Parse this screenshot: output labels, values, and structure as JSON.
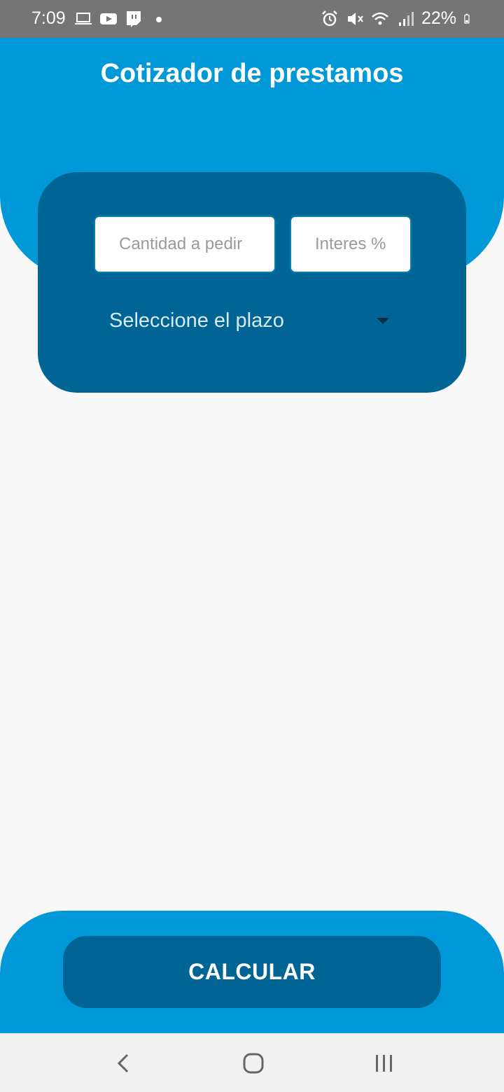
{
  "status_bar": {
    "time": "7:09",
    "battery": "22%",
    "left_icons": [
      "laptop-icon",
      "youtube-icon",
      "twitch-icon",
      "dot-icon"
    ],
    "right_icons": [
      "alarm-icon",
      "mute-icon",
      "wifi-icon",
      "signal-icon",
      "battery-icon"
    ]
  },
  "header": {
    "title": "Cotizador de prestamos",
    "color": "#0098d6"
  },
  "form": {
    "amount_placeholder": "Cantidad a pedir",
    "rate_placeholder": "Interes %",
    "term_select_label": "Seleccione el plazo",
    "card_color": "#006594"
  },
  "actions": {
    "calculate_label": "CALCULAR"
  },
  "nav_bar": {
    "items": [
      "back-icon",
      "home-icon",
      "recent-apps-icon"
    ]
  }
}
